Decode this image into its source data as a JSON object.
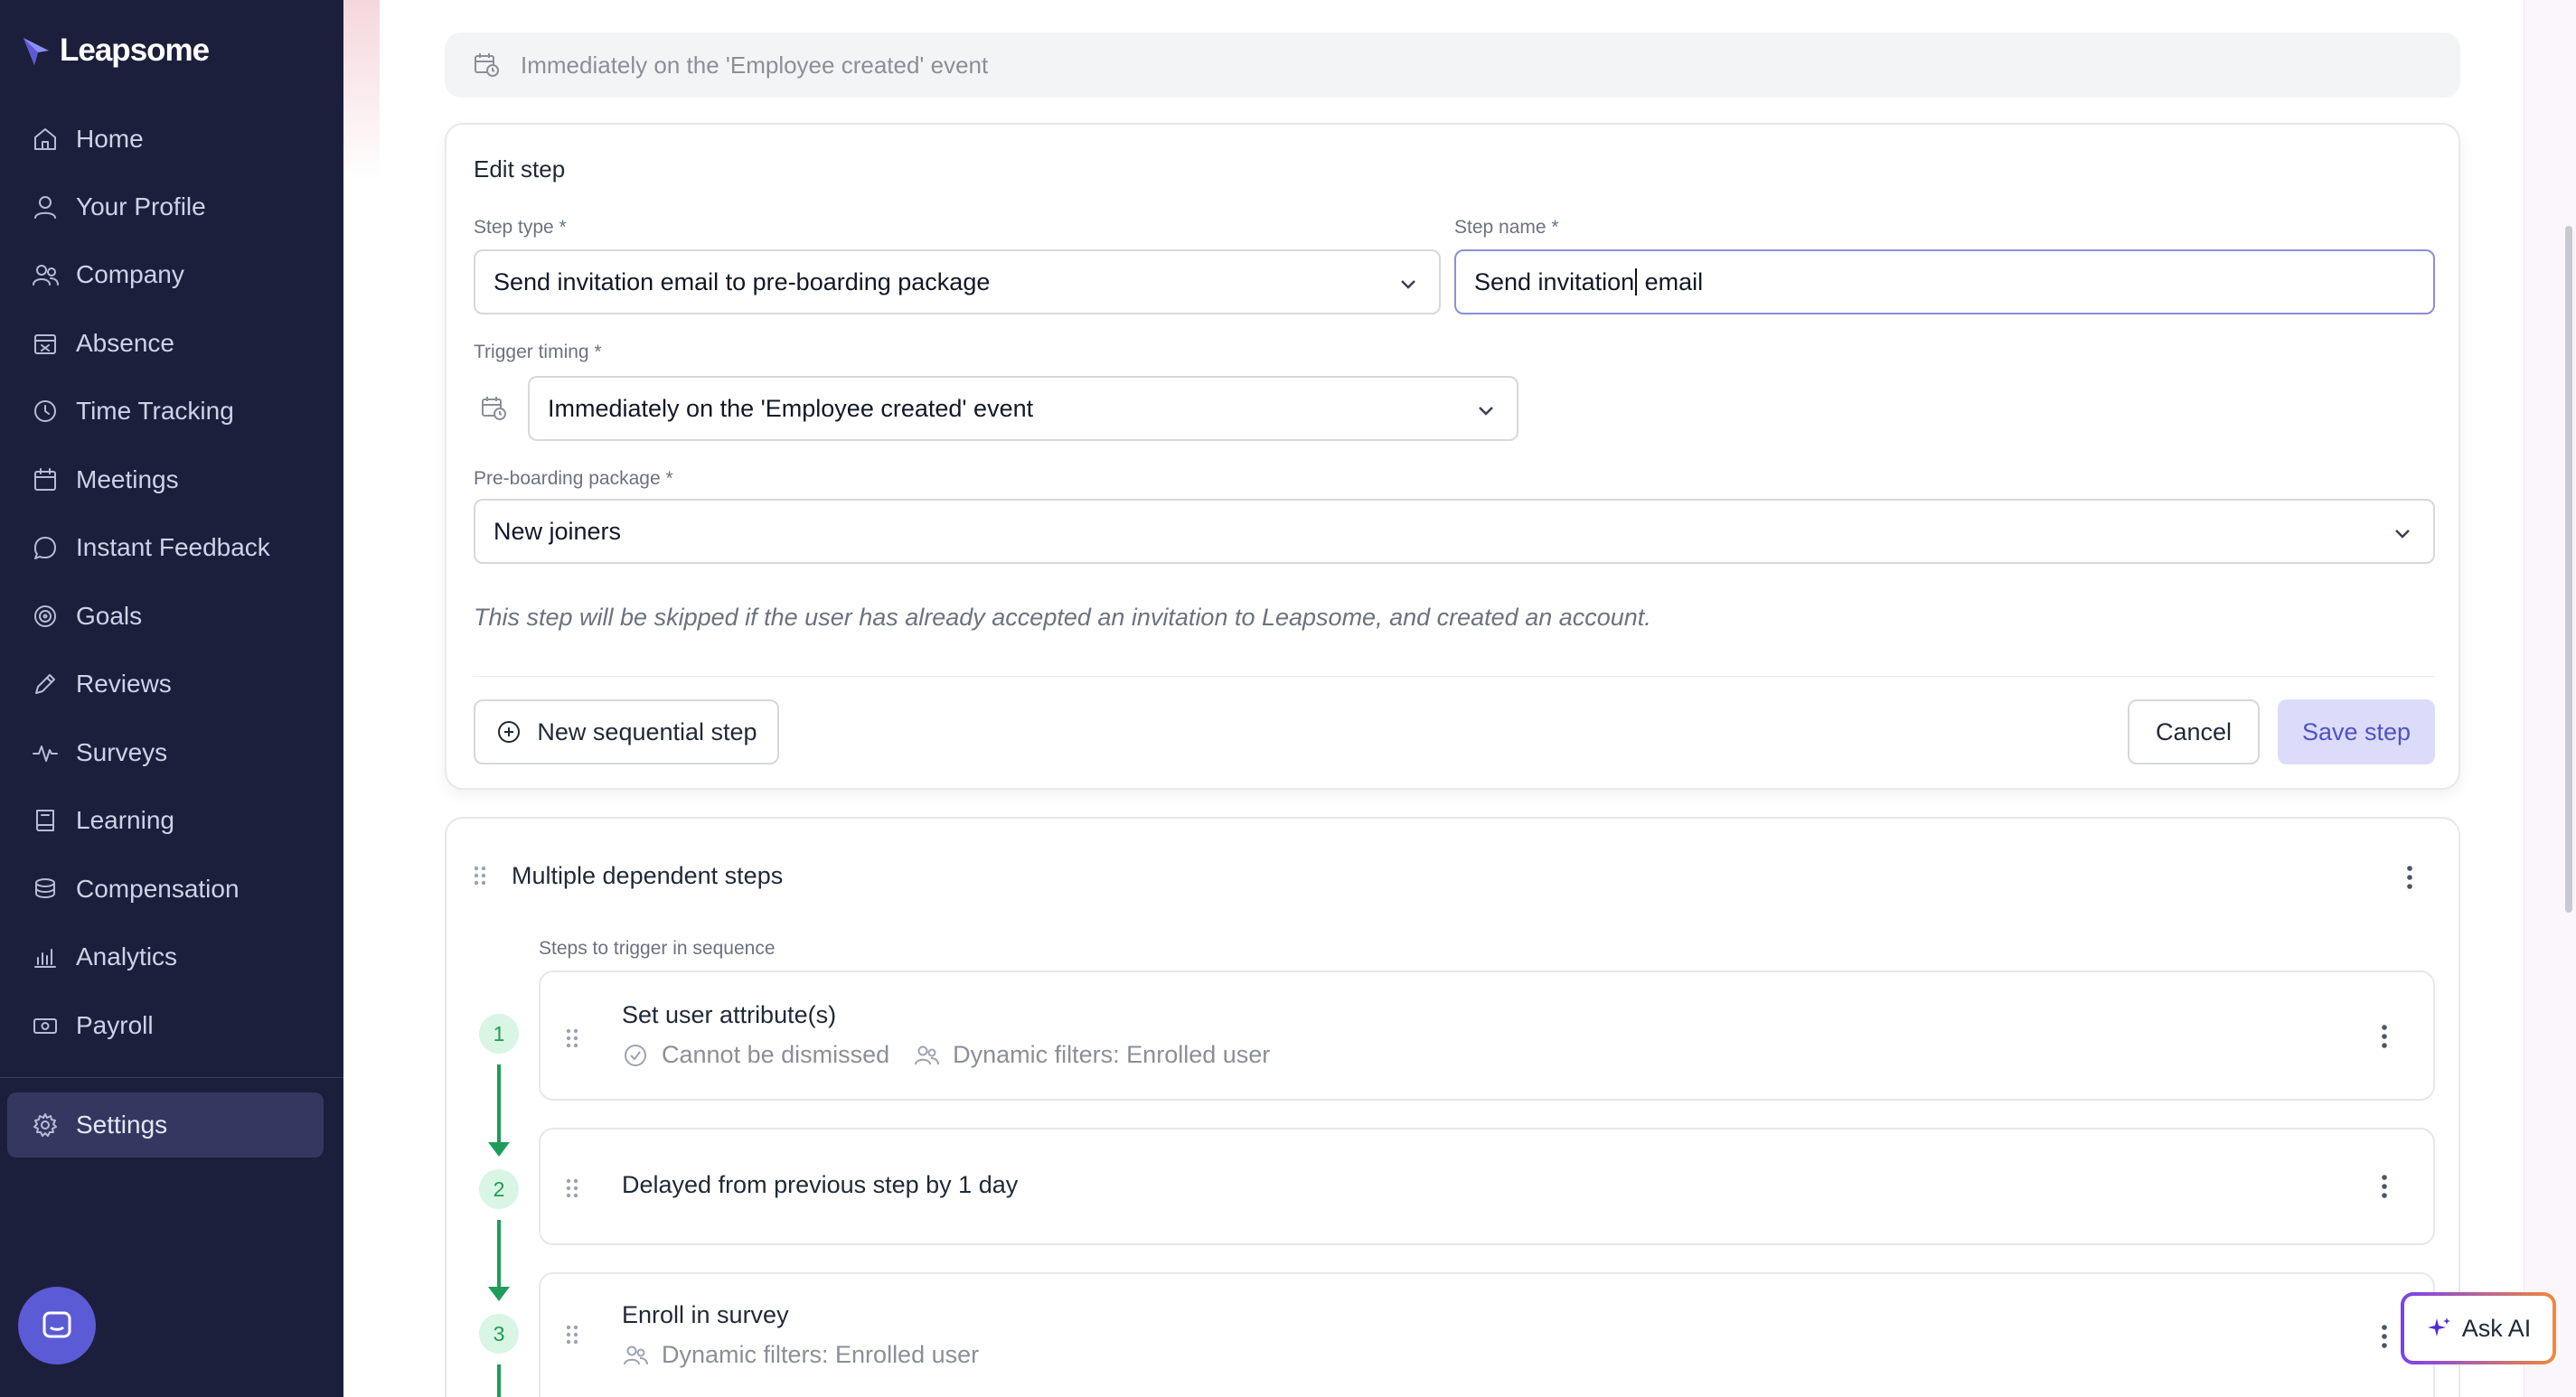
{
  "app": {
    "name": "Leapsome"
  },
  "sidebar": {
    "items": [
      {
        "label": "Home",
        "icon": "home-icon"
      },
      {
        "label": "Your Profile",
        "icon": "user-icon"
      },
      {
        "label": "Company",
        "icon": "users-icon"
      },
      {
        "label": "Absence",
        "icon": "calendar-x-icon"
      },
      {
        "label": "Time Tracking",
        "icon": "clock-icon"
      },
      {
        "label": "Meetings",
        "icon": "calendar-icon"
      },
      {
        "label": "Instant Feedback",
        "icon": "chat-icon"
      },
      {
        "label": "Goals",
        "icon": "target-icon"
      },
      {
        "label": "Reviews",
        "icon": "pencil-icon"
      },
      {
        "label": "Surveys",
        "icon": "pulse-icon"
      },
      {
        "label": "Learning",
        "icon": "book-icon"
      },
      {
        "label": "Compensation",
        "icon": "coins-icon"
      },
      {
        "label": "Analytics",
        "icon": "chart-icon"
      },
      {
        "label": "Payroll",
        "icon": "banknote-icon"
      }
    ],
    "settings": {
      "label": "Settings",
      "icon": "gear-icon"
    }
  },
  "trigger_banner": {
    "text": "Immediately on the 'Employee created' event"
  },
  "edit_step": {
    "title": "Edit step",
    "step_type_label": "Step type *",
    "step_type_value": "Send invitation email to pre-boarding package",
    "step_name_label": "Step name *",
    "step_name_before_caret": "Send invitation",
    "step_name_after_caret": " email",
    "trigger_timing_label": "Trigger timing *",
    "trigger_timing_value": "Immediately on the 'Employee created' event",
    "package_label": "Pre-boarding package *",
    "package_value": "New joiners",
    "helper": "This step will be skipped if the user has already accepted an invitation to Leapsome, and created an account.",
    "new_step_button": "New sequential step",
    "cancel_button": "Cancel",
    "save_button": "Save step"
  },
  "dependent": {
    "title": "Multiple dependent steps",
    "sequence_label": "Steps to trigger in sequence",
    "steps": [
      {
        "num": "1",
        "title": "Set user attribute(s)",
        "meta1": "Cannot be dismissed",
        "meta2": "Dynamic filters: Enrolled user"
      },
      {
        "num": "2",
        "title": "Delayed from previous step by 1 day"
      },
      {
        "num": "3",
        "title": "Enroll in survey",
        "meta2": "Dynamic filters: Enrolled user"
      }
    ]
  },
  "ask_ai": {
    "label": "Ask AI"
  },
  "colors": {
    "sidebar_bg": "#1c1f3b",
    "accent": "#5b5bd6",
    "step_green": "#1f9c5b",
    "primary_button_bg": "#dcdcfa"
  }
}
